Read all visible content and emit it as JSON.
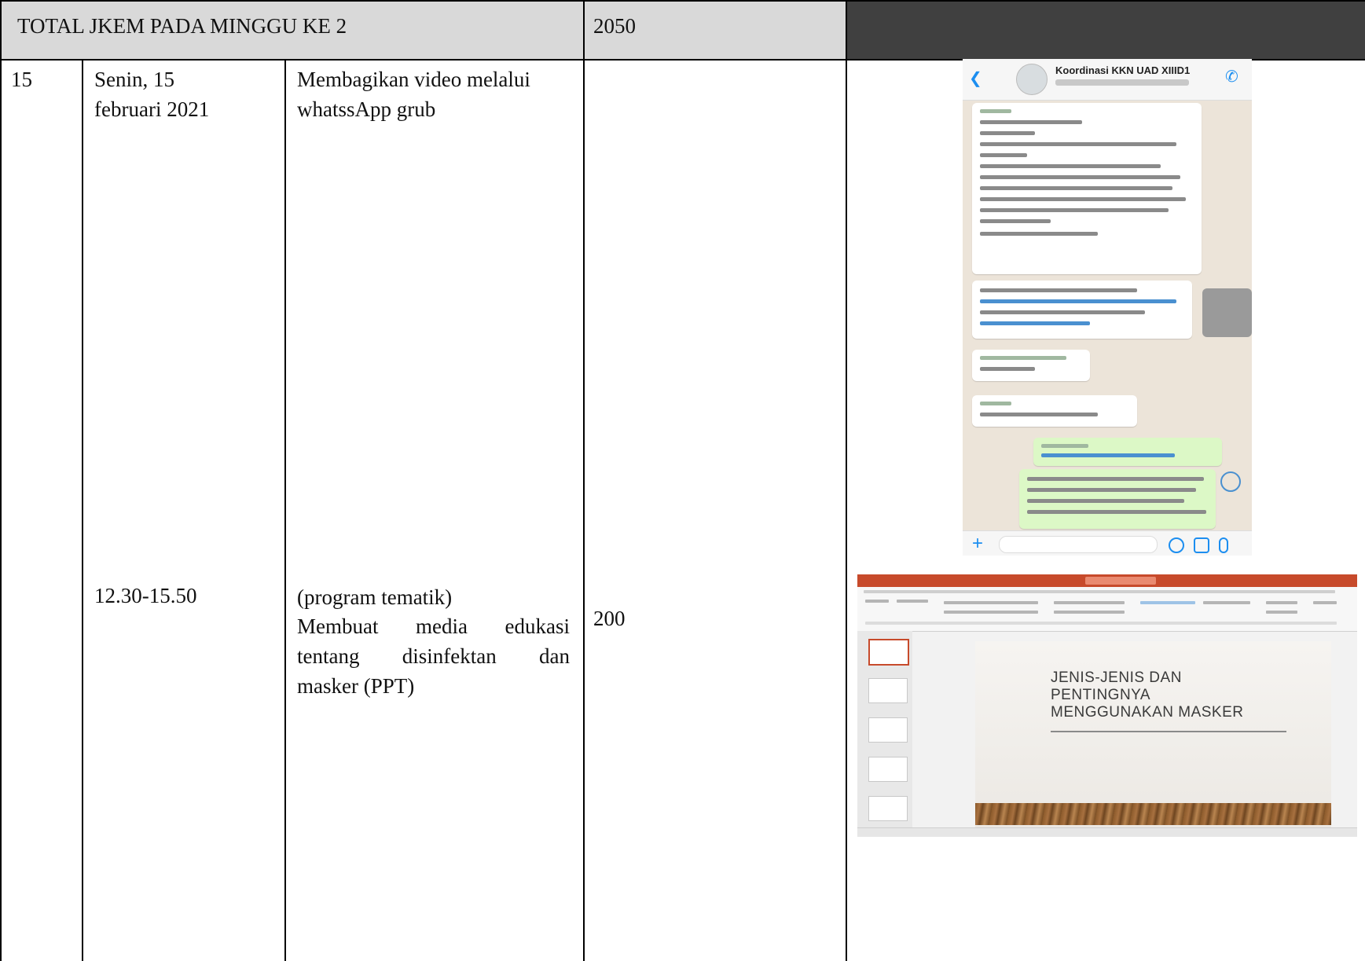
{
  "header": {
    "label": "TOTAL JKEM PADA MINGGU KE 2",
    "total": "2050"
  },
  "row": {
    "number": "15",
    "date_line1": "Senin, 15",
    "date_line2": "februari 2021",
    "activity1_line1": "Membagikan video melalui",
    "activity1_line2": "whatssApp grub",
    "time": "12.30-15.50",
    "activity2_line1": "(program tematik)",
    "activity2_line2": "Membuat media edukasi",
    "activity2_line3": "tentang disinfektan dan",
    "activity2_line4": "masker (PPT)",
    "jkem": "200"
  },
  "whatsapp": {
    "group_name": "Koordinasi KKN UAD XIIID1",
    "back_icon": "chevron-left-icon",
    "call_icon": "phone-add-icon"
  },
  "powerpoint": {
    "slide_title_line1": "JENIS-JENIS DAN",
    "slide_title_line2": "PENTINGNYA",
    "slide_title_line3": "MENGGUNAKAN MASKER"
  },
  "colors": {
    "header_gray": "#d9d9d9",
    "header_dark": "#404040",
    "ppt_accent": "#c74a2b",
    "whatsapp_bg": "#ece4d9"
  }
}
